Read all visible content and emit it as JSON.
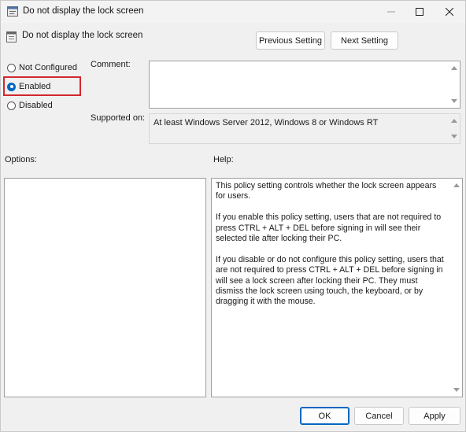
{
  "window": {
    "title": "Do not display the lock screen"
  },
  "header": {
    "policy_name": "Do not display the lock screen",
    "previous_label": "Previous Setting",
    "next_label": "Next Setting"
  },
  "state": {
    "options": [
      {
        "label": "Not Configured",
        "checked": false
      },
      {
        "label": "Enabled",
        "checked": true
      },
      {
        "label": "Disabled",
        "checked": false
      }
    ]
  },
  "fields": {
    "comment_label": "Comment:",
    "comment_value": "",
    "supported_label": "Supported on:",
    "supported_value": "At least Windows Server 2012, Windows 8 or Windows RT"
  },
  "panes": {
    "options_label": "Options:",
    "help_label": "Help:",
    "help_paragraphs": [
      "This policy setting controls whether the lock screen appears for users.",
      "If you enable this policy setting, users that are not required to press CTRL + ALT + DEL before signing in will see their selected tile after locking their PC.",
      "If you disable or do not configure this policy setting, users that are not required to press CTRL + ALT + DEL before signing in will see a lock screen after locking their PC. They must dismiss the lock screen using touch, the keyboard, or by dragging it with the mouse."
    ]
  },
  "footer": {
    "ok_label": "OK",
    "cancel_label": "Cancel",
    "apply_label": "Apply"
  },
  "colors": {
    "accent": "#0067c0",
    "highlight_border": "#d1282f"
  }
}
